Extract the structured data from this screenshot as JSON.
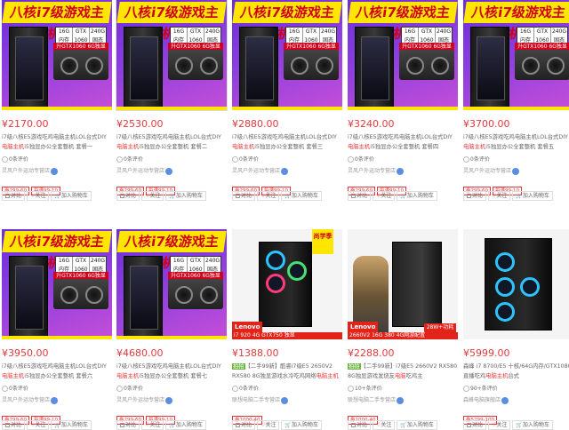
{
  "banner": {
    "title": "八核i7级游戏主机",
    "specs": [
      "16G 内存",
      "GTX 1060",
      "240G 固态"
    ],
    "gpu_tag": "升GTX1060 6G独显"
  },
  "promo": {
    "lenovo": "Lenovo",
    "pennant": "尚学季",
    "bar9": "i7 920 4G GTX750 独显",
    "bar10": "2660V2 16G 380 4G网游配置",
    "watt": "28W+功耗"
  },
  "actions": {
    "compare": "对比",
    "follow": "关注",
    "add_cart": "加入购物车"
  },
  "products": [
    {
      "price": "¥2170.00",
      "desc_plain": "i7级八核E5游戏吃鸡电脑主机LOL台式DIY",
      "desc_red": "电脑主机",
      "desc_tail": "i5独显办公全套整机 套餐一",
      "reviews": "0条评价",
      "store": "灵风户外运动专营店",
      "tags": [
        "券299-60",
        "每满99-10"
      ]
    },
    {
      "price": "¥2530.00",
      "desc_plain": "i7级八核E5游戏吃鸡电脑主机LOL台式DIY",
      "desc_red": "电脑主机",
      "desc_tail": "i5独显办公全套整机 套餐二",
      "reviews": "0条评价",
      "store": "灵风户外运动专营店",
      "tags": [
        "券299-60",
        "每满99-10"
      ]
    },
    {
      "price": "¥2880.00",
      "desc_plain": "i7级八核E5游戏吃鸡电脑主机LOL台式DIY",
      "desc_red": "电脑主机",
      "desc_tail": "i5独显办公全套整机 套餐三",
      "reviews": "0条评价",
      "store": "灵风户外运动专营店",
      "tags": [
        "券299-60",
        "每满99-10"
      ]
    },
    {
      "price": "¥3240.00",
      "desc_plain": "i7级八核E5游戏吃鸡电脑主机LOL台式DIY",
      "desc_red": "电脑主机",
      "desc_tail": "i5独显办公全套整机 套餐四",
      "reviews": "0条评价",
      "store": "灵风户外运动专营店",
      "tags": [
        "券299-60",
        "每满99-10"
      ]
    },
    {
      "price": "¥3700.00",
      "desc_plain": "i7级八核E5游戏吃鸡电脑主机LOL台式DIY",
      "desc_red": "电脑主机",
      "desc_tail": "i5独显办公全套整机 套餐五",
      "reviews": "0条评价",
      "store": "灵风户外运动专营店",
      "tags": [
        "券299-60",
        "每满99-10"
      ]
    },
    {
      "price": "¥3950.00",
      "desc_plain": "i7级八核E5游戏吃鸡电脑主机LOL台式DIY",
      "desc_red": "电脑主机",
      "desc_tail": "i5独显办公全套整机 套餐六",
      "reviews": "0条评价",
      "store": "灵风户外运动专营店",
      "tags": [
        "券299-60",
        "每满99-10"
      ]
    },
    {
      "price": "¥4680.00",
      "desc_plain": "i7级八核E5游戏吃鸡电脑主机LOL台式DIY",
      "desc_red": "电脑主机",
      "desc_tail": "i5独显办公全套整机 套餐七",
      "reviews": "0条评价",
      "store": "灵风户外运动专营店",
      "tags": [
        "券299-60",
        "每满99-10"
      ]
    },
    {
      "price": "¥1388.00",
      "new": "拍拍",
      "desc_plain": "【二手99新】酷睿i7级E5 2650V2 RX580 8G独显游戏水冷吃鸡网络",
      "desc_red": "电脑主机",
      "desc_tail": "台式",
      "reviews": "0条评价",
      "store": "联想电脑二手专营店",
      "tags": [
        "券1000-40"
      ]
    },
    {
      "price": "¥2288.00",
      "new": "拍拍",
      "desc_plain": "【二手99新】i7级E5 2660V2 RX580 8G独显游戏发烧友",
      "desc_red": "电脑",
      "desc_tail": "吃鸡主",
      "reviews": "10+条评价",
      "store": "联想电脑二手专营店",
      "tags": [
        "券1000-40"
      ]
    },
    {
      "price": "¥5999.00",
      "desc_plain": "森峰 i7 8700/E5 十核/64G内存/GTX1080直播吃鸡",
      "desc_red": "电脑主机",
      "desc_tail": "台式",
      "reviews": "90+条评价",
      "store": "森峰电脑旗舰店",
      "tags": [
        "券5299-100"
      ]
    }
  ]
}
